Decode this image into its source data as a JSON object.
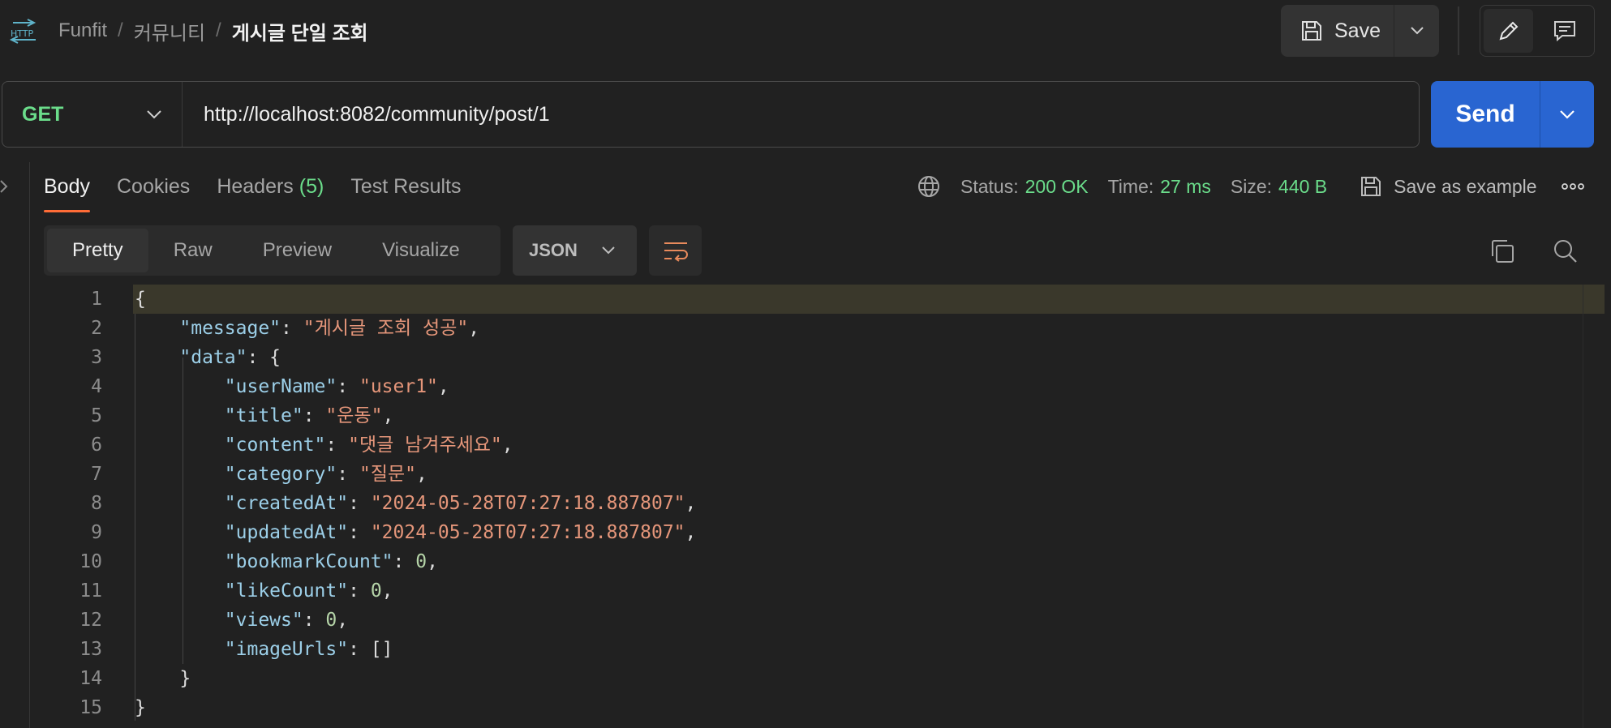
{
  "breadcrumb": {
    "items": [
      "Funfit",
      "커뮤니티"
    ],
    "separator": "/",
    "current": "게시글 단일 조회"
  },
  "toolbar": {
    "save_label": "Save"
  },
  "request": {
    "method": "GET",
    "url": "http://localhost:8082/community/post/1",
    "send_label": "Send"
  },
  "response": {
    "tabs": [
      {
        "label": "Body",
        "count": ""
      },
      {
        "label": "Cookies",
        "count": ""
      },
      {
        "label": "Headers",
        "count": "(5)"
      },
      {
        "label": "Test Results",
        "count": ""
      }
    ],
    "status_label": "Status:",
    "status_value": "200 OK",
    "time_label": "Time:",
    "time_value": "27 ms",
    "size_label": "Size:",
    "size_value": "440 B",
    "save_example_label": "Save as example"
  },
  "body_view": {
    "tabs": [
      "Pretty",
      "Raw",
      "Preview",
      "Visualize"
    ],
    "format": "JSON"
  },
  "code": {
    "line_numbers": [
      "1",
      "2",
      "3",
      "4",
      "5",
      "6",
      "7",
      "8",
      "9",
      "10",
      "11",
      "12",
      "13",
      "14",
      "15"
    ],
    "lines": [
      [
        {
          "t": "p",
          "v": "{"
        }
      ],
      [
        {
          "t": "p",
          "v": "    "
        },
        {
          "t": "k",
          "v": "\"message\""
        },
        {
          "t": "p",
          "v": ": "
        },
        {
          "t": "s",
          "v": "\"게시글 조회 성공\""
        },
        {
          "t": "p",
          "v": ","
        }
      ],
      [
        {
          "t": "p",
          "v": "    "
        },
        {
          "t": "k",
          "v": "\"data\""
        },
        {
          "t": "p",
          "v": ": {"
        }
      ],
      [
        {
          "t": "p",
          "v": "        "
        },
        {
          "t": "k",
          "v": "\"userName\""
        },
        {
          "t": "p",
          "v": ": "
        },
        {
          "t": "s",
          "v": "\"user1\""
        },
        {
          "t": "p",
          "v": ","
        }
      ],
      [
        {
          "t": "p",
          "v": "        "
        },
        {
          "t": "k",
          "v": "\"title\""
        },
        {
          "t": "p",
          "v": ": "
        },
        {
          "t": "s",
          "v": "\"운동\""
        },
        {
          "t": "p",
          "v": ","
        }
      ],
      [
        {
          "t": "p",
          "v": "        "
        },
        {
          "t": "k",
          "v": "\"content\""
        },
        {
          "t": "p",
          "v": ": "
        },
        {
          "t": "s",
          "v": "\"댓글 남겨주세요\""
        },
        {
          "t": "p",
          "v": ","
        }
      ],
      [
        {
          "t": "p",
          "v": "        "
        },
        {
          "t": "k",
          "v": "\"category\""
        },
        {
          "t": "p",
          "v": ": "
        },
        {
          "t": "s",
          "v": "\"질문\""
        },
        {
          "t": "p",
          "v": ","
        }
      ],
      [
        {
          "t": "p",
          "v": "        "
        },
        {
          "t": "k",
          "v": "\"createdAt\""
        },
        {
          "t": "p",
          "v": ": "
        },
        {
          "t": "s",
          "v": "\"2024-05-28T07:27:18.887807\""
        },
        {
          "t": "p",
          "v": ","
        }
      ],
      [
        {
          "t": "p",
          "v": "        "
        },
        {
          "t": "k",
          "v": "\"updatedAt\""
        },
        {
          "t": "p",
          "v": ": "
        },
        {
          "t": "s",
          "v": "\"2024-05-28T07:27:18.887807\""
        },
        {
          "t": "p",
          "v": ","
        }
      ],
      [
        {
          "t": "p",
          "v": "        "
        },
        {
          "t": "k",
          "v": "\"bookmarkCount\""
        },
        {
          "t": "p",
          "v": ": "
        },
        {
          "t": "n",
          "v": "0"
        },
        {
          "t": "p",
          "v": ","
        }
      ],
      [
        {
          "t": "p",
          "v": "        "
        },
        {
          "t": "k",
          "v": "\"likeCount\""
        },
        {
          "t": "p",
          "v": ": "
        },
        {
          "t": "n",
          "v": "0"
        },
        {
          "t": "p",
          "v": ","
        }
      ],
      [
        {
          "t": "p",
          "v": "        "
        },
        {
          "t": "k",
          "v": "\"views\""
        },
        {
          "t": "p",
          "v": ": "
        },
        {
          "t": "n",
          "v": "0"
        },
        {
          "t": "p",
          "v": ","
        }
      ],
      [
        {
          "t": "p",
          "v": "        "
        },
        {
          "t": "k",
          "v": "\"imageUrls\""
        },
        {
          "t": "p",
          "v": ": []"
        }
      ],
      [
        {
          "t": "p",
          "v": "    }"
        }
      ],
      [
        {
          "t": "p",
          "v": "}"
        }
      ]
    ]
  },
  "colors": {
    "accent_orange": "#ff6c37",
    "send_blue": "#2965d1",
    "status_green": "#6bdd8b",
    "json_key": "#9ccfe8",
    "json_string": "#e5967a",
    "json_number": "#b5d4a8"
  },
  "icons": {
    "app": "http-icon",
    "save": "save-icon",
    "edit": "pencil-icon",
    "comments": "comment-icon",
    "network": "globe-icon",
    "wrap": "wrap-lines-icon",
    "copy": "copy-icon",
    "search": "search-icon"
  }
}
